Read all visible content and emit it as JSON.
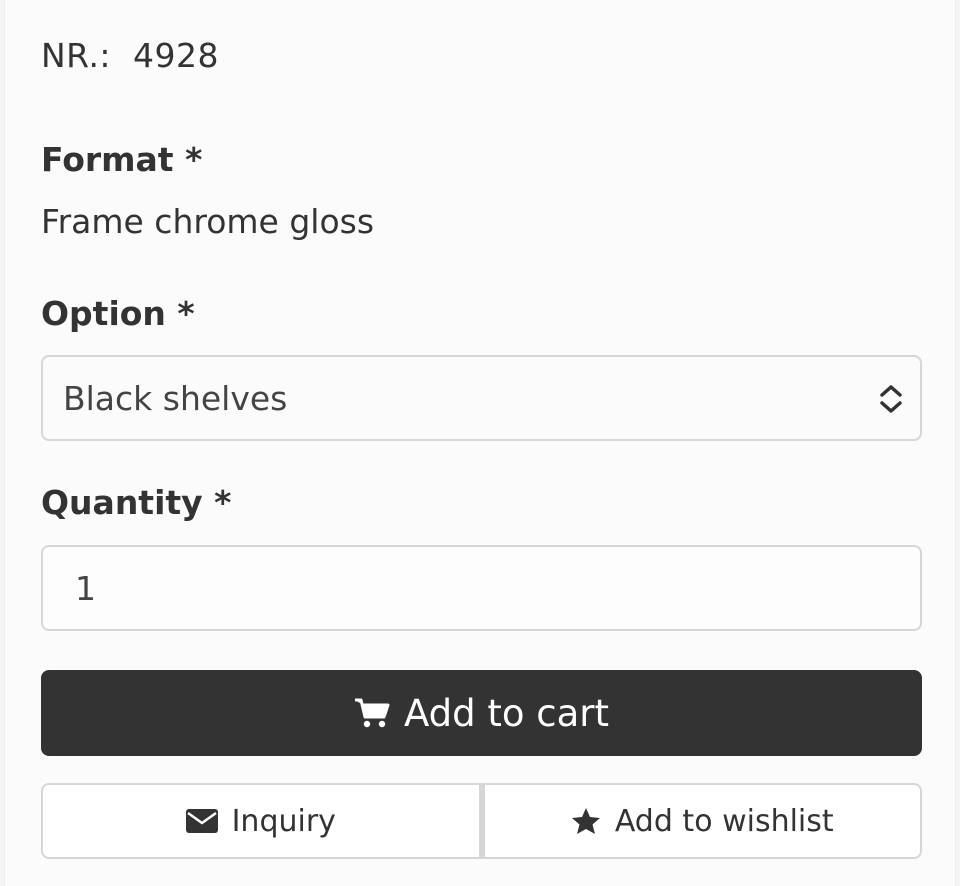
{
  "product": {
    "nr_label": "NR.:",
    "nr_value": "4928"
  },
  "format": {
    "label": "Format *",
    "value": "Frame chrome gloss"
  },
  "option": {
    "label": "Option *",
    "selected": "Black shelves"
  },
  "quantity": {
    "label": "Quantity *",
    "value": "1"
  },
  "actions": {
    "add_to_cart": "Add to cart",
    "inquiry": "Inquiry",
    "add_to_wishlist": "Add to wishlist"
  },
  "icons": {
    "cart": "cart-icon",
    "envelope": "envelope-icon",
    "star": "star-icon",
    "select_arrow": "updown-chevron-icon"
  },
  "colors": {
    "primary_button": "#333333",
    "border": "#d6d6d6"
  }
}
